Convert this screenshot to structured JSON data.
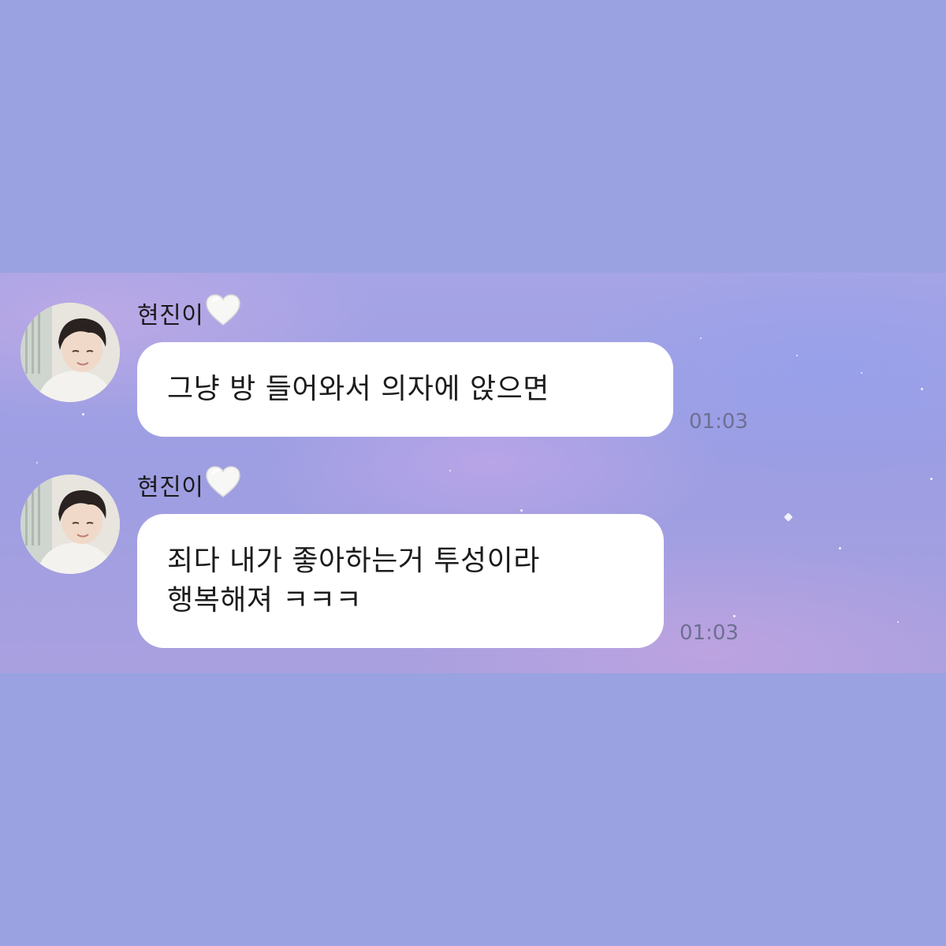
{
  "chat": {
    "messages": [
      {
        "sender": "현진이",
        "heart": "🤍",
        "lines": [
          "그냥 방 들어와서 의자에 앉으면"
        ],
        "time": "01:03",
        "avatar_icon": "profile-photo"
      },
      {
        "sender": "현진이",
        "heart": "🤍",
        "lines": [
          "죄다 내가 좋아하는거 투성이라",
          "행복해져 ㅋㅋㅋ"
        ],
        "time": "01:03",
        "avatar_icon": "profile-photo"
      }
    ]
  },
  "colors": {
    "page_background": "#9aa2e1",
    "bubble": "#ffffff",
    "timestamp": "#6e6f93"
  }
}
